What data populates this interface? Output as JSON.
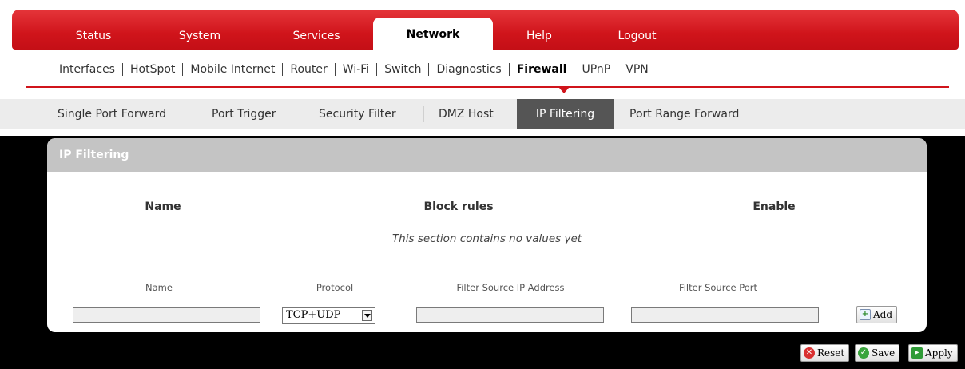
{
  "main_nav": [
    "Status",
    "System",
    "Services",
    "Network",
    "Help",
    "Logout"
  ],
  "main_nav_active": "Network",
  "sub_nav": [
    "Interfaces",
    "HotSpot",
    "Mobile Internet",
    "Router",
    "Wi-Fi",
    "Switch",
    "Diagnostics",
    "Firewall",
    "UPnP",
    "VPN"
  ],
  "sub_nav_active": "Firewall",
  "tert_nav": [
    "Single Port Forward",
    "Port Trigger",
    "Security Filter",
    "DMZ Host",
    "IP Filtering",
    "Port Range Forward"
  ],
  "tert_nav_active": "IP Filtering",
  "panel": {
    "title": "IP Filtering",
    "columns": [
      "Name",
      "Block rules",
      "Enable"
    ],
    "empty_message": "This section contains no values yet",
    "form": {
      "name_label": "Name",
      "protocol_label": "Protocol",
      "src_ip_label": "Filter Source IP Address",
      "src_port_label": "Filter Source Port",
      "name_value": "",
      "protocol_value": "TCP+UDP",
      "src_ip_value": "",
      "src_port_value": "",
      "add_label": "Add"
    }
  },
  "actions": {
    "reset_label": "Reset",
    "save_label": "Save",
    "apply_label": "Apply"
  },
  "colors": {
    "brand_red": "#d0141b",
    "panel_header": "#c4c4c4",
    "active_tab_dark": "#555555"
  }
}
